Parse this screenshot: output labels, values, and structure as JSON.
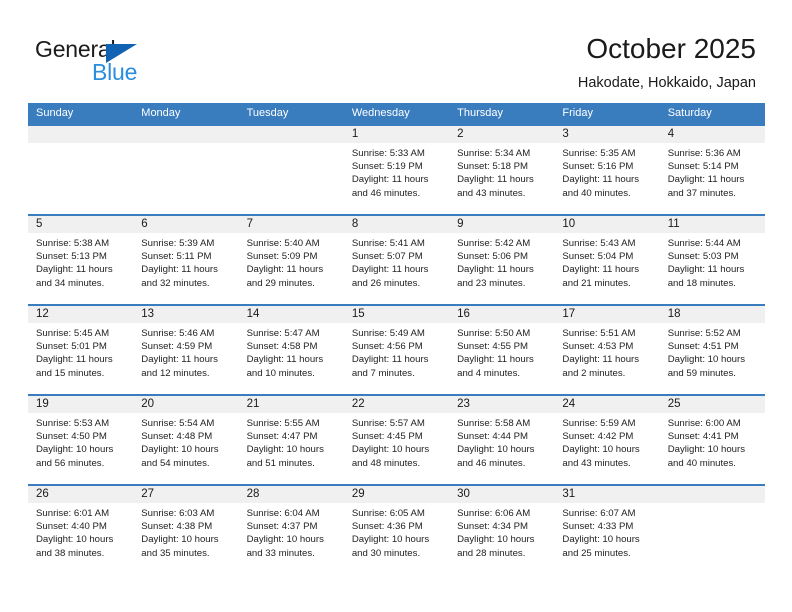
{
  "brand": {
    "name_top": "General",
    "name_bottom": "Blue",
    "accent_color": "#2b8ddd",
    "triangle_color": "#1262b3"
  },
  "header": {
    "title": "October 2025",
    "subtitle": "Hakodate, Hokkaido, Japan"
  },
  "calendar": {
    "header_bg": "#3a7dbf",
    "daynum_bg": "#f0f0f0",
    "weekdays": [
      "Sunday",
      "Monday",
      "Tuesday",
      "Wednesday",
      "Thursday",
      "Friday",
      "Saturday"
    ],
    "weeks": [
      [
        {
          "day": "",
          "empty": true
        },
        {
          "day": "",
          "empty": true
        },
        {
          "day": "",
          "empty": true
        },
        {
          "day": "1",
          "sunrise": "Sunrise: 5:33 AM",
          "sunset": "Sunset: 5:19 PM",
          "daylight": "Daylight: 11 hours and 46 minutes."
        },
        {
          "day": "2",
          "sunrise": "Sunrise: 5:34 AM",
          "sunset": "Sunset: 5:18 PM",
          "daylight": "Daylight: 11 hours and 43 minutes."
        },
        {
          "day": "3",
          "sunrise": "Sunrise: 5:35 AM",
          "sunset": "Sunset: 5:16 PM",
          "daylight": "Daylight: 11 hours and 40 minutes."
        },
        {
          "day": "4",
          "sunrise": "Sunrise: 5:36 AM",
          "sunset": "Sunset: 5:14 PM",
          "daylight": "Daylight: 11 hours and 37 minutes."
        }
      ],
      [
        {
          "day": "5",
          "sunrise": "Sunrise: 5:38 AM",
          "sunset": "Sunset: 5:13 PM",
          "daylight": "Daylight: 11 hours and 34 minutes."
        },
        {
          "day": "6",
          "sunrise": "Sunrise: 5:39 AM",
          "sunset": "Sunset: 5:11 PM",
          "daylight": "Daylight: 11 hours and 32 minutes."
        },
        {
          "day": "7",
          "sunrise": "Sunrise: 5:40 AM",
          "sunset": "Sunset: 5:09 PM",
          "daylight": "Daylight: 11 hours and 29 minutes."
        },
        {
          "day": "8",
          "sunrise": "Sunrise: 5:41 AM",
          "sunset": "Sunset: 5:07 PM",
          "daylight": "Daylight: 11 hours and 26 minutes."
        },
        {
          "day": "9",
          "sunrise": "Sunrise: 5:42 AM",
          "sunset": "Sunset: 5:06 PM",
          "daylight": "Daylight: 11 hours and 23 minutes."
        },
        {
          "day": "10",
          "sunrise": "Sunrise: 5:43 AM",
          "sunset": "Sunset: 5:04 PM",
          "daylight": "Daylight: 11 hours and 21 minutes."
        },
        {
          "day": "11",
          "sunrise": "Sunrise: 5:44 AM",
          "sunset": "Sunset: 5:03 PM",
          "daylight": "Daylight: 11 hours and 18 minutes."
        }
      ],
      [
        {
          "day": "12",
          "sunrise": "Sunrise: 5:45 AM",
          "sunset": "Sunset: 5:01 PM",
          "daylight": "Daylight: 11 hours and 15 minutes."
        },
        {
          "day": "13",
          "sunrise": "Sunrise: 5:46 AM",
          "sunset": "Sunset: 4:59 PM",
          "daylight": "Daylight: 11 hours and 12 minutes."
        },
        {
          "day": "14",
          "sunrise": "Sunrise: 5:47 AM",
          "sunset": "Sunset: 4:58 PM",
          "daylight": "Daylight: 11 hours and 10 minutes."
        },
        {
          "day": "15",
          "sunrise": "Sunrise: 5:49 AM",
          "sunset": "Sunset: 4:56 PM",
          "daylight": "Daylight: 11 hours and 7 minutes."
        },
        {
          "day": "16",
          "sunrise": "Sunrise: 5:50 AM",
          "sunset": "Sunset: 4:55 PM",
          "daylight": "Daylight: 11 hours and 4 minutes."
        },
        {
          "day": "17",
          "sunrise": "Sunrise: 5:51 AM",
          "sunset": "Sunset: 4:53 PM",
          "daylight": "Daylight: 11 hours and 2 minutes."
        },
        {
          "day": "18",
          "sunrise": "Sunrise: 5:52 AM",
          "sunset": "Sunset: 4:51 PM",
          "daylight": "Daylight: 10 hours and 59 minutes."
        }
      ],
      [
        {
          "day": "19",
          "sunrise": "Sunrise: 5:53 AM",
          "sunset": "Sunset: 4:50 PM",
          "daylight": "Daylight: 10 hours and 56 minutes."
        },
        {
          "day": "20",
          "sunrise": "Sunrise: 5:54 AM",
          "sunset": "Sunset: 4:48 PM",
          "daylight": "Daylight: 10 hours and 54 minutes."
        },
        {
          "day": "21",
          "sunrise": "Sunrise: 5:55 AM",
          "sunset": "Sunset: 4:47 PM",
          "daylight": "Daylight: 10 hours and 51 minutes."
        },
        {
          "day": "22",
          "sunrise": "Sunrise: 5:57 AM",
          "sunset": "Sunset: 4:45 PM",
          "daylight": "Daylight: 10 hours and 48 minutes."
        },
        {
          "day": "23",
          "sunrise": "Sunrise: 5:58 AM",
          "sunset": "Sunset: 4:44 PM",
          "daylight": "Daylight: 10 hours and 46 minutes."
        },
        {
          "day": "24",
          "sunrise": "Sunrise: 5:59 AM",
          "sunset": "Sunset: 4:42 PM",
          "daylight": "Daylight: 10 hours and 43 minutes."
        },
        {
          "day": "25",
          "sunrise": "Sunrise: 6:00 AM",
          "sunset": "Sunset: 4:41 PM",
          "daylight": "Daylight: 10 hours and 40 minutes."
        }
      ],
      [
        {
          "day": "26",
          "sunrise": "Sunrise: 6:01 AM",
          "sunset": "Sunset: 4:40 PM",
          "daylight": "Daylight: 10 hours and 38 minutes."
        },
        {
          "day": "27",
          "sunrise": "Sunrise: 6:03 AM",
          "sunset": "Sunset: 4:38 PM",
          "daylight": "Daylight: 10 hours and 35 minutes."
        },
        {
          "day": "28",
          "sunrise": "Sunrise: 6:04 AM",
          "sunset": "Sunset: 4:37 PM",
          "daylight": "Daylight: 10 hours and 33 minutes."
        },
        {
          "day": "29",
          "sunrise": "Sunrise: 6:05 AM",
          "sunset": "Sunset: 4:36 PM",
          "daylight": "Daylight: 10 hours and 30 minutes."
        },
        {
          "day": "30",
          "sunrise": "Sunrise: 6:06 AM",
          "sunset": "Sunset: 4:34 PM",
          "daylight": "Daylight: 10 hours and 28 minutes."
        },
        {
          "day": "31",
          "sunrise": "Sunrise: 6:07 AM",
          "sunset": "Sunset: 4:33 PM",
          "daylight": "Daylight: 10 hours and 25 minutes."
        },
        {
          "day": "",
          "empty": true
        }
      ]
    ]
  }
}
